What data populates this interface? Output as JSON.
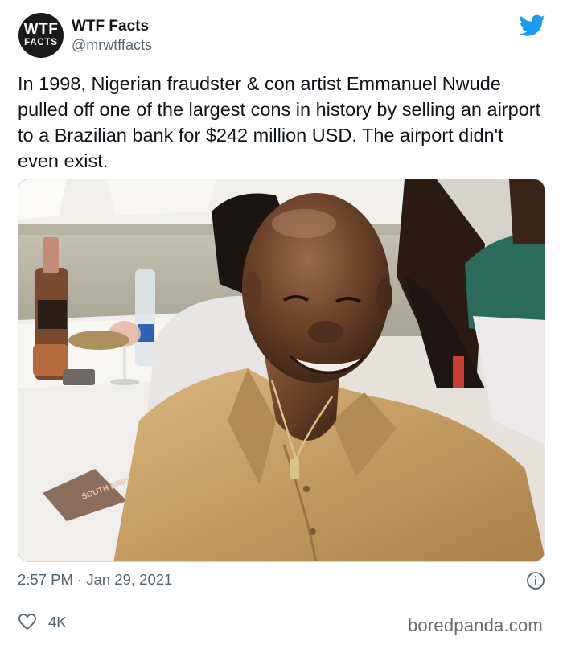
{
  "author": {
    "avatar_line1": "WTF",
    "avatar_line2": "FACTS",
    "name": "WTF Facts",
    "handle": "@mrwtffacts"
  },
  "tweet": {
    "text": "In 1998, Nigerian fraudster & con artist Emmanuel Nwude pulled off one of the largest cons in history by selling an airport to a Brazilian bank for $242 million USD. The airport didn't even exist.",
    "timestamp": "2:57 PM · Jan 29, 2021",
    "likes": "4K"
  },
  "watermark": "boredpanda.com",
  "photo": {
    "magazine_text": "SOUTH BRIDES"
  },
  "icons": {
    "platform": "twitter-bird-icon",
    "info": "info-icon",
    "like": "heart-icon"
  },
  "colors": {
    "twitter_blue": "#1d9bf0",
    "secondary_text": "#536471",
    "divider": "#cfd9de",
    "shirt": "#c9a46c"
  }
}
